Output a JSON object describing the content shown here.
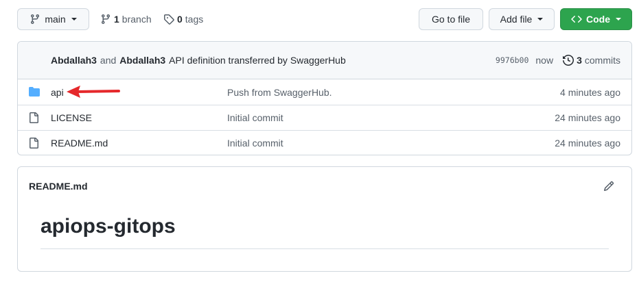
{
  "toolbar": {
    "branch_label": "main",
    "branches_count": "1",
    "branches_label": "branch",
    "tags_count": "0",
    "tags_label": "tags",
    "go_to_file_label": "Go to file",
    "add_file_label": "Add file",
    "code_label": "Code"
  },
  "commit": {
    "author1": "Abdallah3",
    "conjunction": "and",
    "author2": "Abdallah3",
    "message": "API definition transferred by SwaggerHub",
    "sha": "9976b00",
    "time": "now",
    "commits_count": "3",
    "commits_label": "commits"
  },
  "files": [
    {
      "name": "api",
      "type": "folder",
      "message": "Push from SwaggerHub.",
      "time": "4 minutes ago"
    },
    {
      "name": "LICENSE",
      "type": "file",
      "message": "Initial commit",
      "time": "24 minutes ago"
    },
    {
      "name": "README.md",
      "type": "file",
      "message": "Initial commit",
      "time": "24 minutes ago"
    }
  ],
  "readme": {
    "filename": "README.md",
    "heading": "apiops-gitops"
  },
  "colors": {
    "accent_green": "#2da44e",
    "folder_blue": "#54aeff",
    "annotation_red": "#e5282b"
  }
}
